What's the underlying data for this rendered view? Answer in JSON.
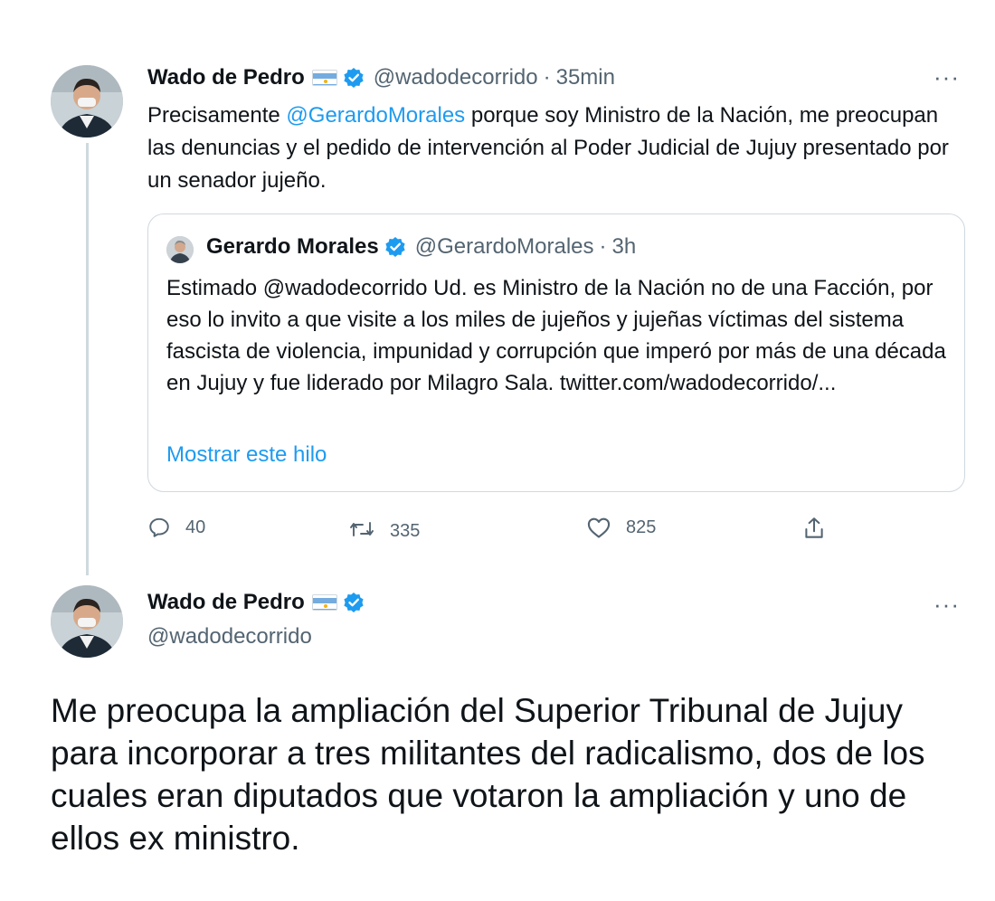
{
  "tweet1": {
    "author_name": "Wado de Pedro",
    "handle": "@wadodecorrido",
    "separator": "·",
    "time": "35min",
    "more": "···",
    "text": {
      "part1": "Precisamente ",
      "mention": "@GerardoMorales",
      "part2": " porque soy Ministro de la Nación, me preocupan las denuncias y el pedido de intervención al Poder Judicial de Jujuy presentado por un senador jujeño."
    },
    "quoted": {
      "author_name": "Gerardo Morales",
      "handle": "@GerardoMorales",
      "separator": "·",
      "time": "3h",
      "text": "Estimado @wadodecorrido Ud. es Ministro de la Nación no de una Facción, por eso lo invito a que visite a los miles de jujeños y jujeñas víctimas del sistema fascista de violencia, impunidad y corrupción que imperó por más de una década en Jujuy y fue liderado por Milagro Sala. twitter.com/wadodecorrido/...",
      "show_thread": "Mostrar este hilo"
    },
    "actions": {
      "replies": "40",
      "retweets": "335",
      "likes": "825"
    },
    "icons": {
      "flag": "argentina-flag-icon",
      "verified": "verified-badge-icon",
      "reply": "reply-icon",
      "retweet": "retweet-icon",
      "like": "heart-icon",
      "share": "share-icon"
    }
  },
  "tweet2": {
    "author_name": "Wado de Pedro",
    "handle": "@wadodecorrido",
    "more": "···",
    "text": "Me preocupa la ampliación del Superior Tribunal de Jujuy para incorporar a tres militantes del radicalismo, dos de los cuales eran diputados que votaron la ampliación y uno de ellos ex ministro."
  },
  "colors": {
    "accent": "#1d9bf0",
    "secondary_text": "#536471",
    "border": "#cfd9de",
    "primary_text": "#0f1419"
  }
}
